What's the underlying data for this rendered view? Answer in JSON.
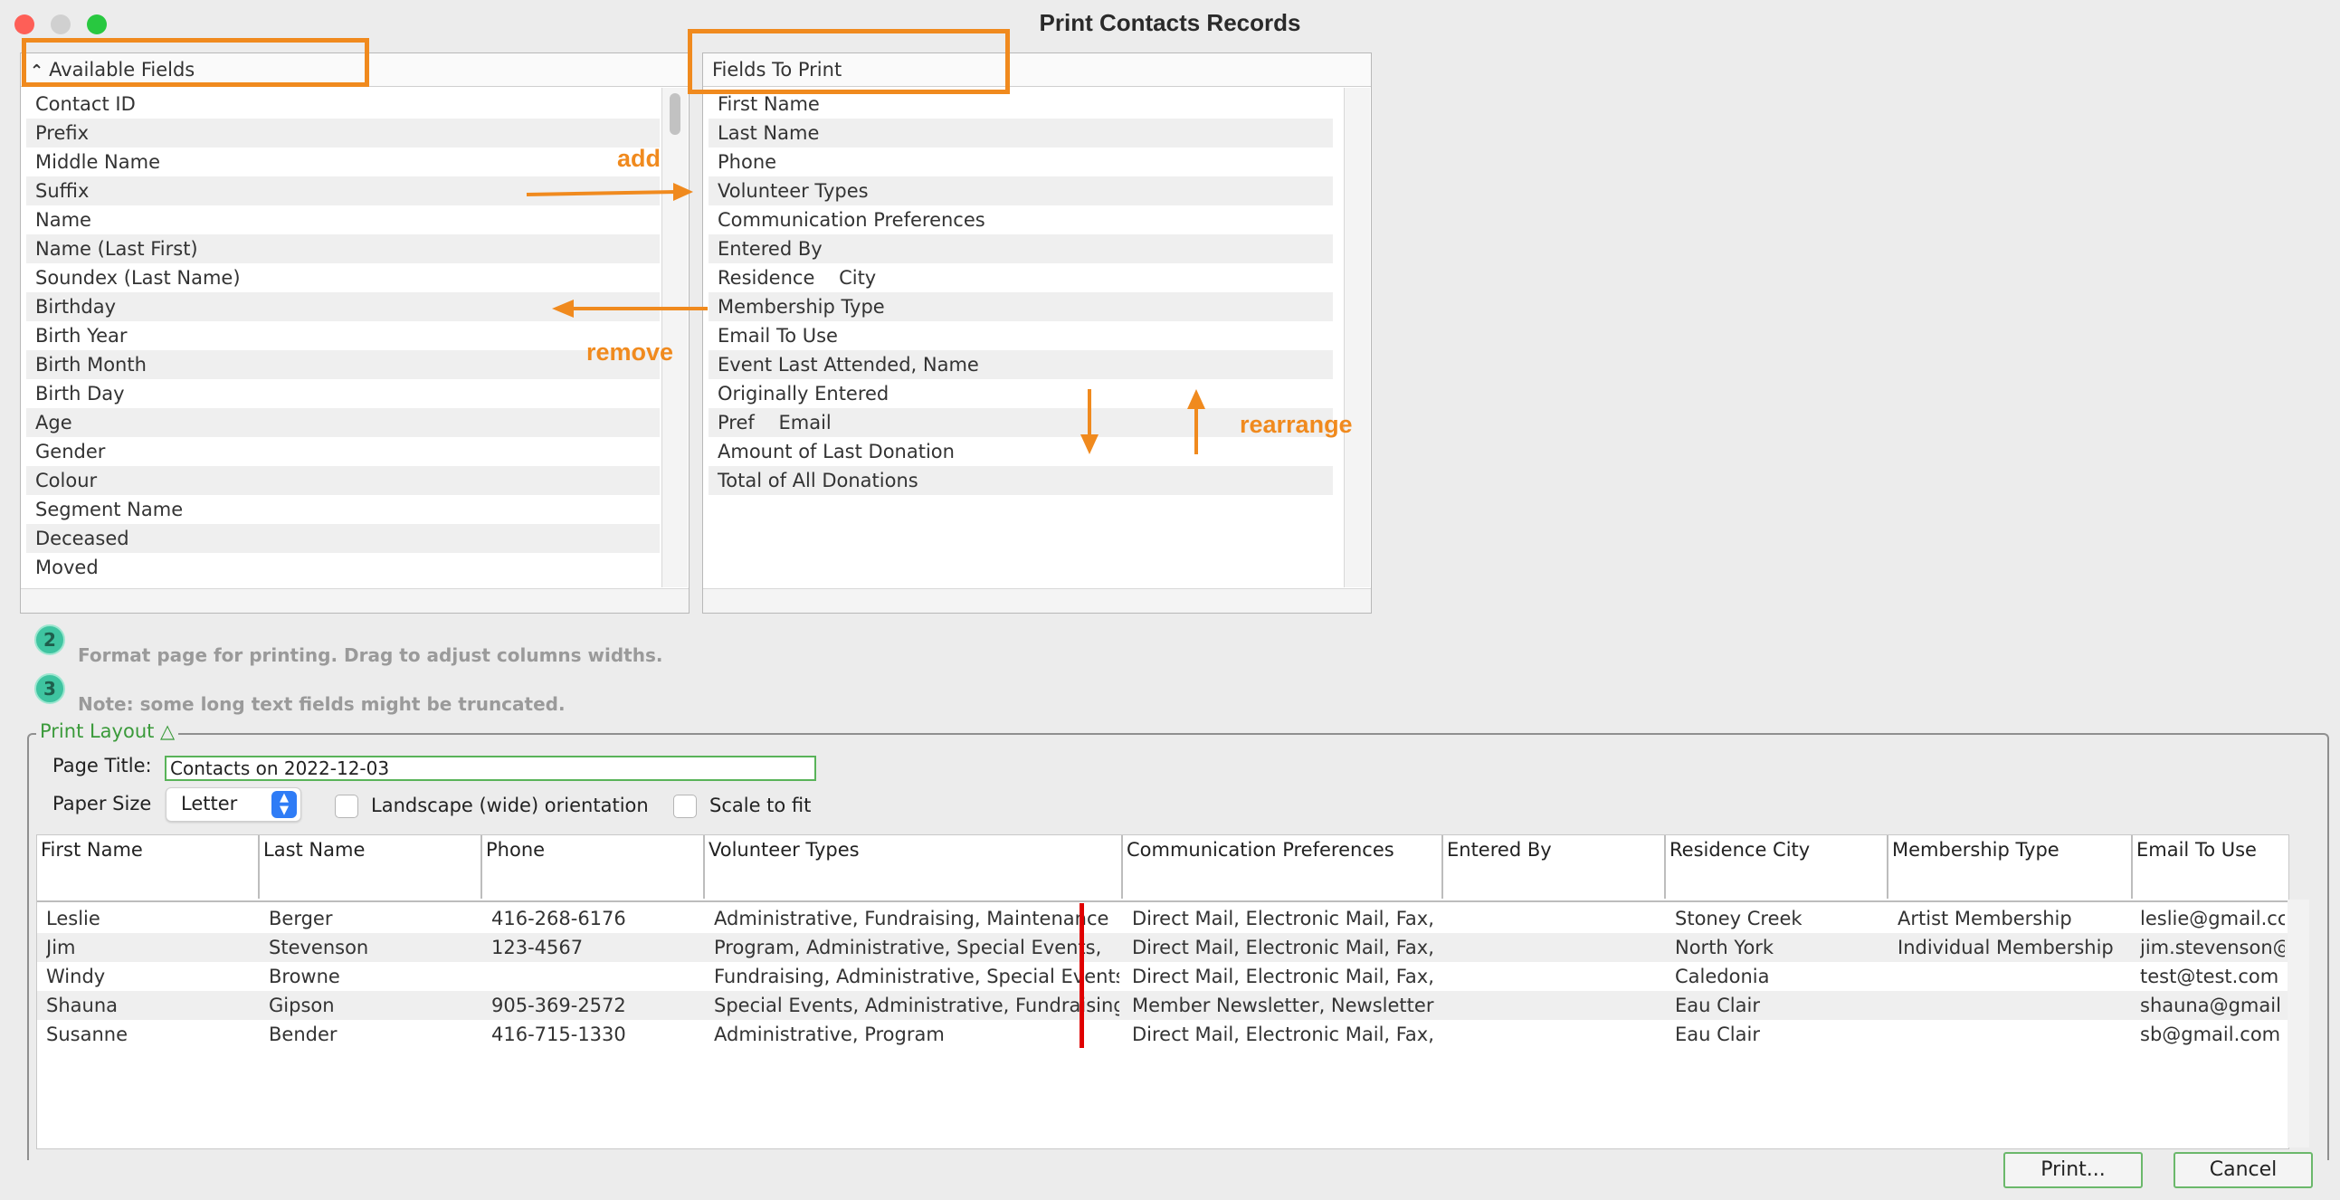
{
  "window": {
    "title": "Print Contacts Records"
  },
  "available": {
    "header": "Available Fields",
    "items": [
      "Contact ID",
      "Prefix",
      "Middle Name",
      "Suffix",
      "Name",
      "Name (Last First)",
      "Soundex (Last Name)",
      "Birthday",
      "Birth Year",
      "Birth Month",
      "Birth Day",
      "Age",
      "Gender",
      "Colour",
      "Segment Name",
      "Deceased",
      "Moved"
    ]
  },
  "to_print": {
    "header": "Fields To Print",
    "items": [
      "First Name",
      "Last Name",
      "Phone",
      "Volunteer Types",
      "Communication Preferences",
      "Entered By",
      "Residence    City",
      "Membership Type",
      "Email To Use",
      "Event Last Attended, Name",
      "Originally Entered",
      "Pref    Email",
      "Amount of Last Donation",
      "Total of All Donations"
    ]
  },
  "annotations": {
    "add": "add",
    "remove": "remove",
    "rearrange": "rearrange"
  },
  "steps": [
    {
      "badge": "2",
      "text": "Format page for printing. Drag to adjust columns widths."
    },
    {
      "badge": "3",
      "text": "Note: some long text fields might be truncated."
    }
  ],
  "layout": {
    "legend": "Print Layout △",
    "page_title_label": "Page Title:",
    "page_title_value": "Contacts on 2022-12-03",
    "paper_size_label": "Paper Size",
    "paper_size_value": "Letter",
    "landscape_label": "Landscape (wide) orientation",
    "scale_label": "Scale to fit"
  },
  "table": {
    "columns": [
      "First Name",
      "Last Name",
      "Phone",
      "Volunteer Types",
      "Communication Preferences",
      "Entered By",
      "Residence City",
      "Membership Type",
      "Email To Use"
    ],
    "rows": [
      [
        "Leslie",
        "Berger",
        "416-268-6176",
        "Administrative, Fundraising, Maintenance",
        "Direct Mail, Electronic Mail, Fax,",
        "",
        "Stoney Creek",
        "Artist Membership",
        "leslie@gmail.cc"
      ],
      [
        "Jim",
        "Stevenson",
        "123-4567",
        "Program, Administrative, Special Events,",
        "Direct Mail, Electronic Mail, Fax,",
        "",
        "North York",
        "Individual Membership",
        "jim.stevenson@"
      ],
      [
        "Windy",
        "Browne",
        "",
        "Fundraising, Administrative, Special Events",
        "Direct Mail, Electronic Mail, Fax,",
        "",
        "Caledonia",
        "",
        "test@test.com"
      ],
      [
        "Shauna",
        "Gipson",
        "905-369-2572",
        "Special Events, Administrative, Fundraising,",
        "Member Newsletter, Newsletter",
        "",
        "Eau Clair",
        "",
        "shauna@gmail"
      ],
      [
        "Susanne",
        "Bender",
        "416-715-1330",
        "Administrative, Program",
        "Direct Mail, Electronic Mail, Fax,",
        "",
        "Eau Clair",
        "",
        "sb@gmail.com"
      ]
    ]
  },
  "buttons": {
    "print": "Print...",
    "cancel": "Cancel"
  },
  "colors": {
    "annotation": "#f08a1e",
    "accent_green": "#59b359",
    "close": "#fe5f57",
    "zoom": "#28c840"
  }
}
